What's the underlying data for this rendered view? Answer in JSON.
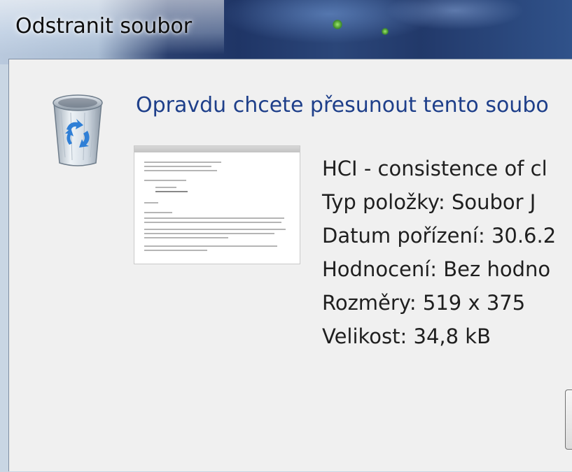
{
  "window": {
    "title": "Odstranit soubor"
  },
  "dialog": {
    "question": "Opravdu chcete přesunout tento soubo",
    "icon": "recycle-bin-icon",
    "thumbnail": "document-thumbnail",
    "file": {
      "name": "HCI - consistence of cl",
      "type": "Typ položky: Soubor J",
      "date": "Datum pořízení: 30.6.2",
      "rating": "Hodnocení: Bez hodno",
      "dimensions": "Rozměry: 519 x 375",
      "size": "Velikost: 34,8 kB"
    }
  },
  "colors": {
    "question_text": "#1e3f8a",
    "client_background": "#f0f0f0"
  }
}
